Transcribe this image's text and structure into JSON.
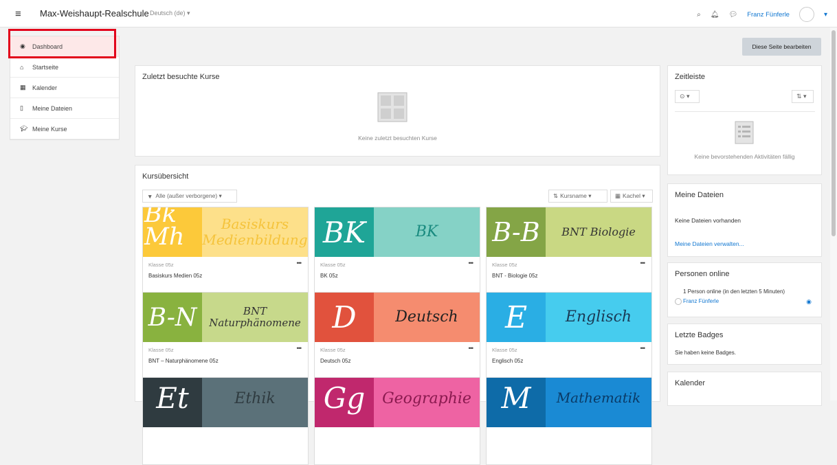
{
  "navbar": {
    "site_name": "Max-Weishaupt-Realschule",
    "language": "Deutsch (de) ▾",
    "user_name": "Franz Fünferle",
    "icons": [
      "search-icon",
      "bell-icon",
      "chat-icon",
      "avatar",
      "caret-down-icon"
    ]
  },
  "sidebar": {
    "items": [
      {
        "label": "Dashboard",
        "icon": "tachometer-icon"
      },
      {
        "label": "Startseite",
        "icon": "home-icon"
      },
      {
        "label": "Kalender",
        "icon": "calendar-icon"
      },
      {
        "label": "Meine Dateien",
        "icon": "file-icon"
      },
      {
        "label": "Meine Kurse",
        "icon": "graduation-cap-icon"
      }
    ]
  },
  "edit_button": "Diese Seite bearbeiten",
  "recent": {
    "title": "Zuletzt besuchte Kurse",
    "empty": "Keine zuletzt besuchten Kurse"
  },
  "overview": {
    "title": "Kursübersicht",
    "filter": "Alle (außer verborgene) ▾",
    "sort": "Kursname ▾",
    "view": "Kachel ▾",
    "courses": [
      {
        "left": "Bk Mh",
        "right": "Basiskurs Medienbildung",
        "category": "Klasse 05z",
        "name": "Basiskurs Medien 05z"
      },
      {
        "left": "BK",
        "right": "BK",
        "category": "Klasse 05z",
        "name": "BK 05z"
      },
      {
        "left": "B-B",
        "right": "BNT Biologie",
        "category": "Klasse 05z",
        "name": "BNT - Biologie 05z"
      },
      {
        "left": "B-N",
        "right": "BNT Naturphänomene",
        "category": "Klasse 05z",
        "name": "BNT – Naturphänomene 05z"
      },
      {
        "left": "D",
        "right": "Deutsch",
        "category": "Klasse 05z",
        "name": "Deutsch 05z"
      },
      {
        "left": "E",
        "right": "Englisch",
        "category": "Klasse 05z",
        "name": "Englisch 05z"
      },
      {
        "left": "Et",
        "right": "Ethik"
      },
      {
        "left": "Gg",
        "right": "Geographie"
      },
      {
        "left": "M",
        "right": "Mathematik"
      }
    ],
    "colors": {
      "c1_left": "#fcc93a",
      "c1_right": "#fde08a",
      "c1_text": "#f5c33b",
      "c2_left": "#1fa597",
      "c2_right": "#85d2c6",
      "c2_text": "#1a8b80",
      "c3_left": "#84a546",
      "c3_right": "#c9d883",
      "c3_text": "#333333",
      "c4_left": "#89b23f",
      "c4_right": "#c7d98b",
      "c4_text": "#333333",
      "c5_left": "#e1523d",
      "c5_right": "#f58c6f",
      "c5_text": "#222222",
      "c6_left": "#2aaee4",
      "c6_right": "#46ccee",
      "c6_text": "#1a3a55",
      "c7_left": "#2f3b40",
      "c7_right": "#5b7179",
      "c8_left": "#c0286d",
      "c8_right": "#ee63a3",
      "c9_left": "#0e6ba8",
      "c9_right": "#1a8ad4"
    }
  },
  "timeline": {
    "title": "Zeitleiste",
    "empty": "Keine bevorstehenden Aktivitäten fällig"
  },
  "files": {
    "title": "Meine Dateien",
    "text": "Keine Dateien vorhanden",
    "link": "Meine Dateien verwalten..."
  },
  "online": {
    "title": "Personen online",
    "text": "1 Person online (in den letzten 5 Minuten)",
    "user": "Franz Fünferle"
  },
  "badges": {
    "title": "Letzte Badges",
    "text": "Sie haben keine Badges."
  },
  "calendar": {
    "title": "Kalender"
  }
}
